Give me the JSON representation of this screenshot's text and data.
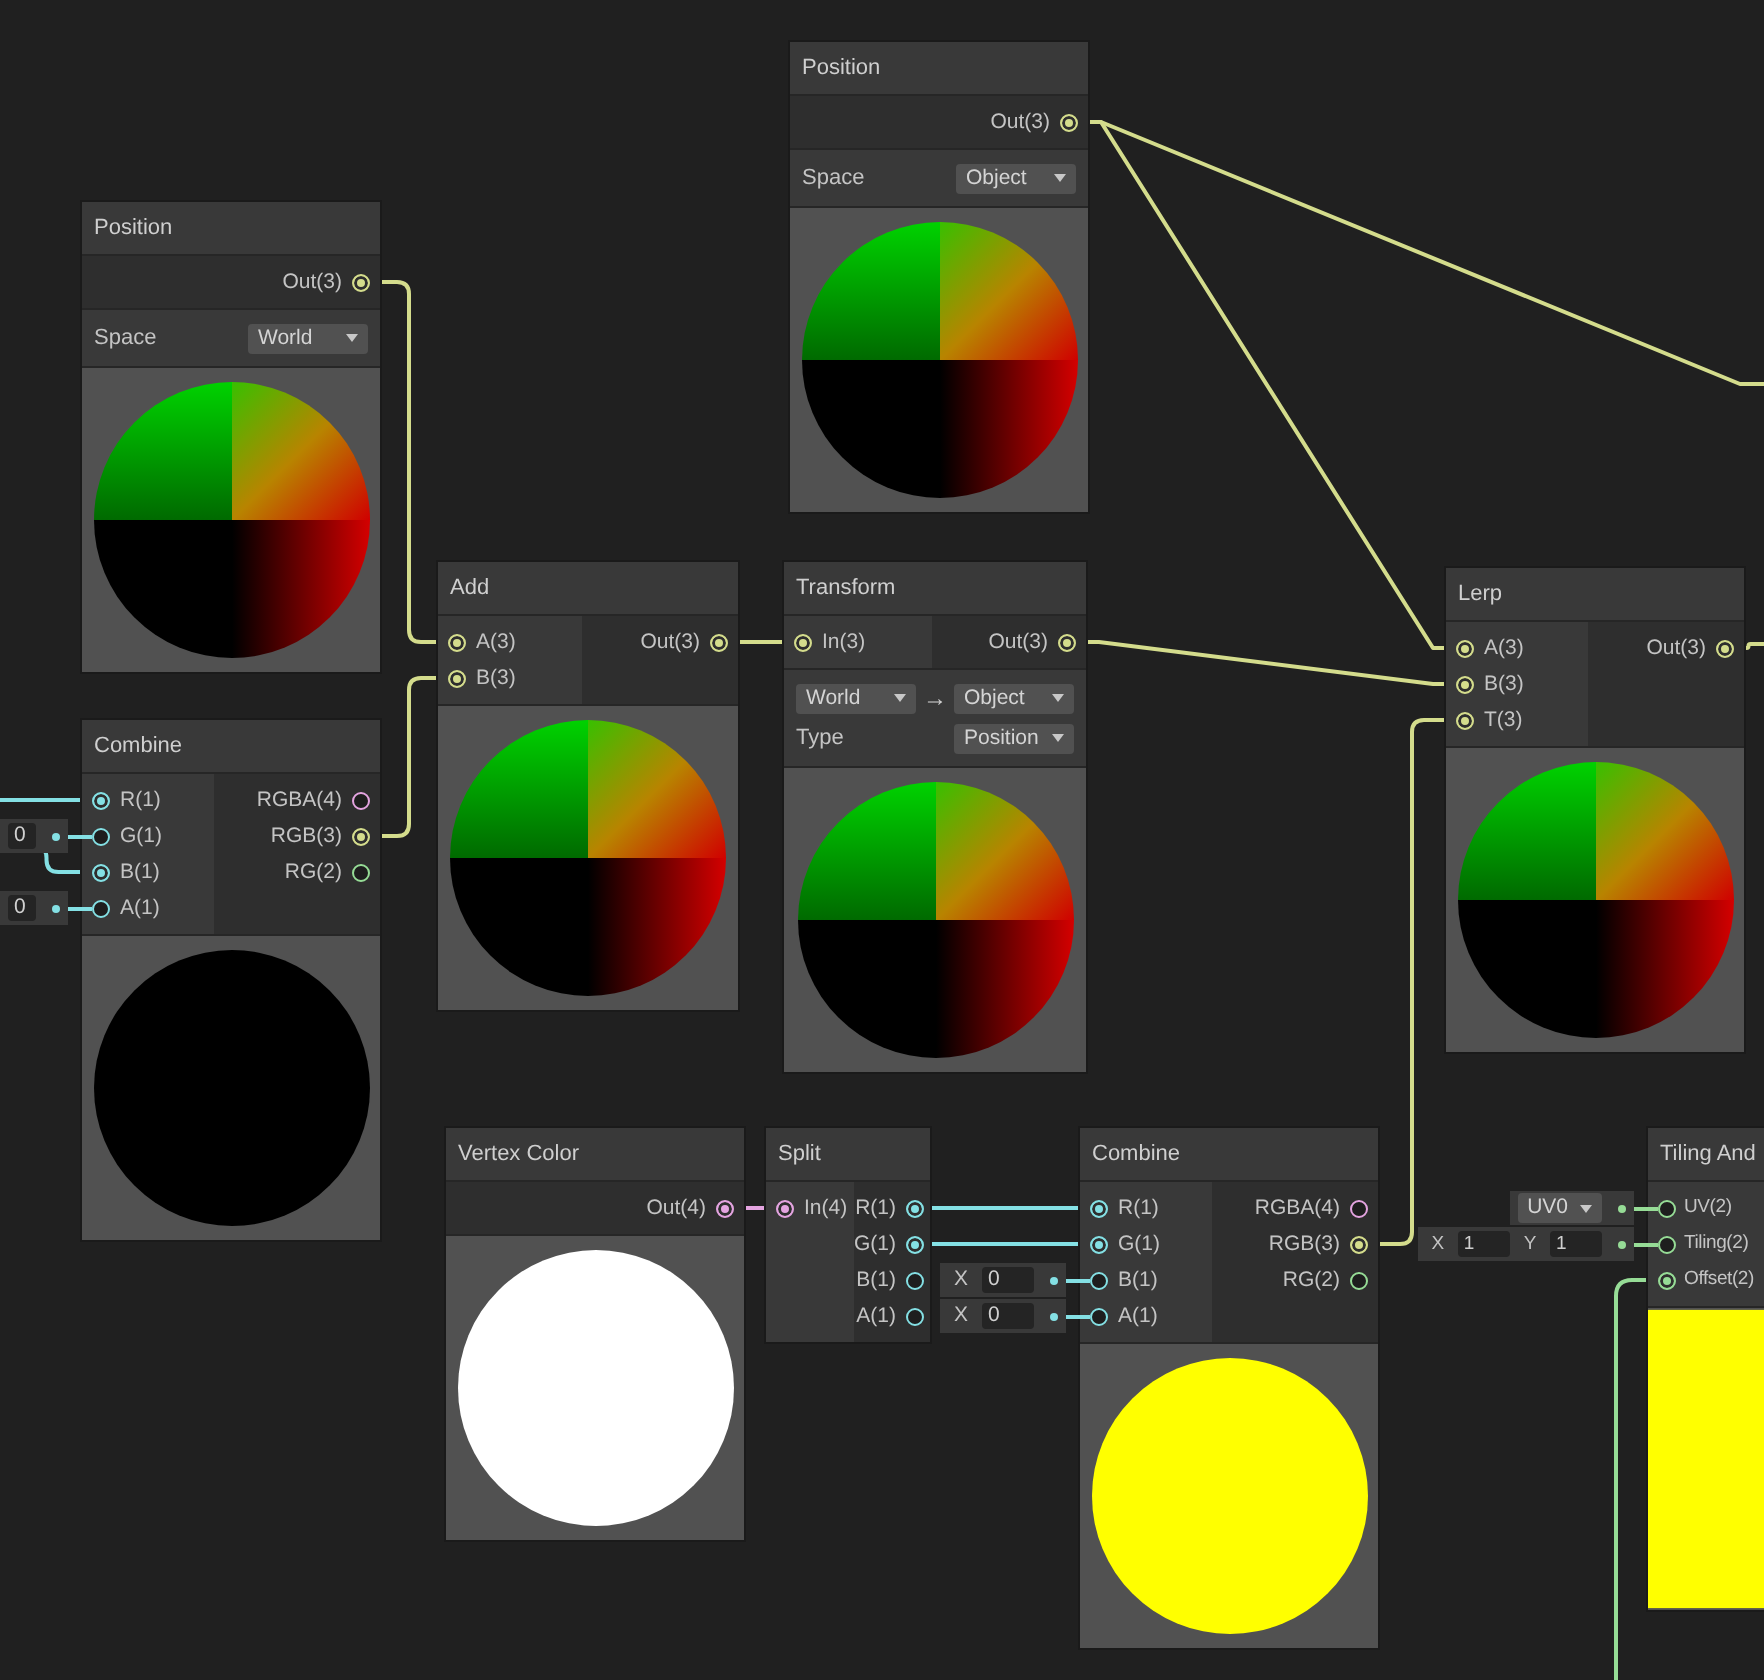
{
  "nodes": [
    {
      "title": "Position",
      "outputs": [
        {
          "label": "Out(3)",
          "color": "#d4dc8c",
          "connected": true
        }
      ],
      "controls": [
        {
          "kind": "dropdown",
          "label": "Space",
          "value": "World"
        }
      ],
      "preview": {
        "kind": "sphere"
      }
    },
    {
      "title": "Position",
      "outputs": [
        {
          "label": "Out(3)",
          "color": "#d4dc8c",
          "connected": true
        }
      ],
      "controls": [
        {
          "kind": "dropdown",
          "label": "Space",
          "value": "Object"
        }
      ],
      "preview": {
        "kind": "sphere"
      }
    },
    {
      "title": "Add",
      "inputs": [
        {
          "label": "A(3)",
          "color": "#d4dc8c",
          "connected": true
        },
        {
          "label": "B(3)",
          "color": "#d4dc8c",
          "connected": true
        }
      ],
      "outputs": [
        {
          "label": "Out(3)",
          "color": "#d4dc8c",
          "connected": true
        }
      ],
      "preview": {
        "kind": "sphere"
      }
    },
    {
      "title": "Transform",
      "inputs": [
        {
          "label": "In(3)",
          "color": "#d4dc8c",
          "connected": true
        }
      ],
      "outputs": [
        {
          "label": "Out(3)",
          "color": "#d4dc8c",
          "connected": true
        }
      ],
      "controls": [
        {
          "kind": "conversion",
          "from": "World",
          "arrow": "→",
          "to": "Object"
        },
        {
          "kind": "dropdown",
          "label": "Type",
          "value": "Position"
        }
      ],
      "preview": {
        "kind": "sphere"
      }
    },
    {
      "title": "Lerp",
      "inputs": [
        {
          "label": "A(3)",
          "color": "#d4dc8c",
          "connected": true
        },
        {
          "label": "B(3)",
          "color": "#d4dc8c",
          "connected": true
        },
        {
          "label": "T(3)",
          "color": "#d4dc8c",
          "connected": true
        }
      ],
      "outputs": [
        {
          "label": "Out(3)",
          "color": "#d4dc8c",
          "connected": true
        }
      ],
      "preview": {
        "kind": "sphere"
      }
    },
    {
      "title": "Combine",
      "inputs": [
        {
          "label": "R(1)",
          "color": "#84e0e4",
          "connected": true
        },
        {
          "label": "G(1)",
          "color": "#84e0e4",
          "connected": false,
          "field": {
            "parts": [
              {
                "value": "0"
              }
            ]
          }
        },
        {
          "label": "B(1)",
          "color": "#84e0e4",
          "connected": true
        },
        {
          "label": "A(1)",
          "color": "#84e0e4",
          "connected": false,
          "field": {
            "parts": [
              {
                "value": "0"
              }
            ]
          }
        }
      ],
      "outputs": [
        {
          "label": "RGBA(4)",
          "color": "#e4a4e0",
          "connected": false
        },
        {
          "label": "RGB(3)",
          "color": "#d4dc8c",
          "connected": true
        },
        {
          "label": "RG(2)",
          "color": "#96dc96",
          "connected": false
        }
      ],
      "preview": {
        "kind": "solid",
        "color": "#000000"
      }
    },
    {
      "title": "Vertex Color",
      "outputs": [
        {
          "label": "Out(4)",
          "color": "#e4a4e0",
          "connected": true
        }
      ],
      "preview": {
        "kind": "solid",
        "color": "#ffffff"
      }
    },
    {
      "title": "Split",
      "inputs": [
        {
          "label": "In(4)",
          "color": "#e4a4e0",
          "connected": true
        }
      ],
      "outputs": [
        {
          "label": "R(1)",
          "color": "#84e0e4",
          "connected": true
        },
        {
          "label": "G(1)",
          "color": "#84e0e4",
          "connected": true
        },
        {
          "label": "B(1)",
          "color": "#84e0e4",
          "connected": false
        },
        {
          "label": "A(1)",
          "color": "#84e0e4",
          "connected": false
        }
      ]
    },
    {
      "title": "Combine",
      "inputs": [
        {
          "label": "R(1)",
          "color": "#84e0e4",
          "connected": true
        },
        {
          "label": "G(1)",
          "color": "#84e0e4",
          "connected": true
        },
        {
          "label": "B(1)",
          "color": "#84e0e4",
          "connected": false,
          "field": {
            "parts": [
              {
                "label": "X",
                "value": "0"
              }
            ]
          }
        },
        {
          "label": "A(1)",
          "color": "#84e0e4",
          "connected": false,
          "field": {
            "parts": [
              {
                "label": "X",
                "value": "0"
              }
            ]
          }
        }
      ],
      "outputs": [
        {
          "label": "RGBA(4)",
          "color": "#e4a4e0",
          "connected": false
        },
        {
          "label": "RGB(3)",
          "color": "#d4dc8c",
          "connected": true
        },
        {
          "label": "RG(2)",
          "color": "#96dc96",
          "connected": false
        }
      ],
      "preview": {
        "kind": "solid",
        "color": "#ffff00"
      }
    },
    {
      "title": "Tiling And",
      "inputs": [
        {
          "label": "UV(2)",
          "color": "#96dc96",
          "connected": false,
          "field": {
            "dropdown": "UV0"
          }
        },
        {
          "label": "Tiling(2)",
          "color": "#96dc96",
          "connected": false,
          "field": {
            "parts": [
              {
                "label": "X",
                "value": "1"
              },
              {
                "label": "Y",
                "value": "1"
              }
            ]
          }
        },
        {
          "label": "Offset(2)",
          "color": "#96dc96",
          "connected": true
        }
      ],
      "preview": {
        "kind": "fill",
        "color": "#ffff00"
      }
    }
  ]
}
